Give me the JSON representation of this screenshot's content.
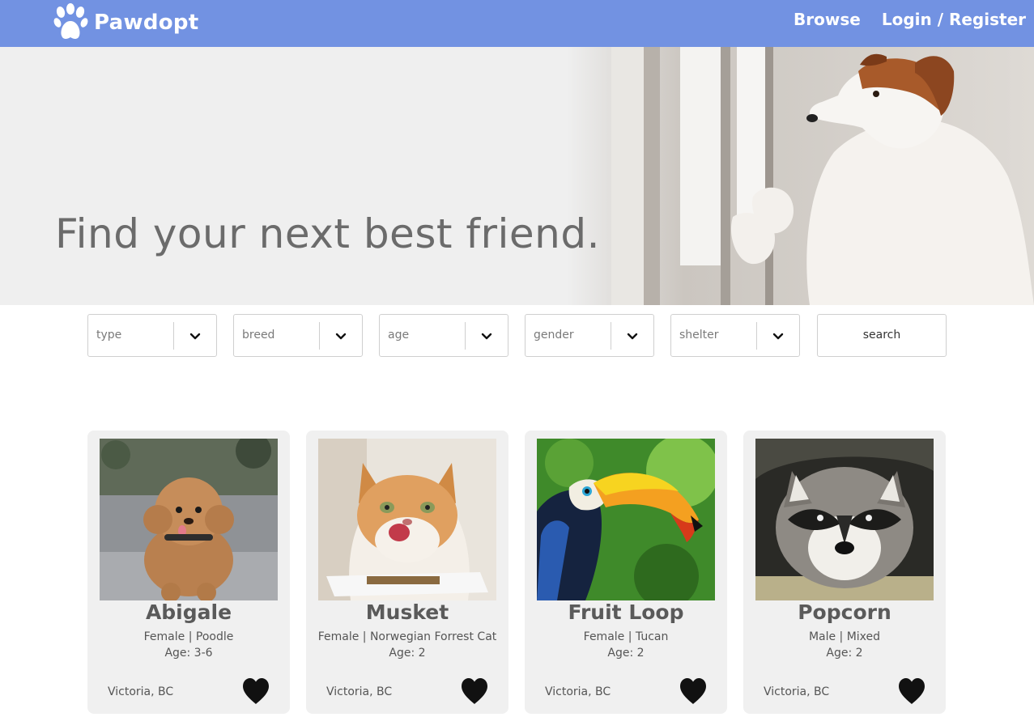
{
  "header": {
    "logo_text": "Pawdopt",
    "nav": [
      "Browse",
      "Login / Register"
    ],
    "color": "#7292e2"
  },
  "hero": {
    "title": "Find your next best friend."
  },
  "filters": [
    {
      "placeholder": "type"
    },
    {
      "placeholder": "breed"
    },
    {
      "placeholder": "age"
    },
    {
      "placeholder": "gender"
    },
    {
      "placeholder": "shelter"
    }
  ],
  "search": {
    "label": "search"
  },
  "pets": [
    {
      "name": "Abigale",
      "info": "Female | Poodle",
      "age": "Age: 3-6",
      "location": "Victoria, BC",
      "image": "poodle-photo"
    },
    {
      "name": "Musket",
      "info": "Female | Norwegian Forrest Cat",
      "age": "Age: 2",
      "location": "Victoria, BC",
      "image": "cat-photo"
    },
    {
      "name": "Fruit Loop",
      "info": "Female | Tucan",
      "age": "Age: 2",
      "location": "Victoria, BC",
      "image": "toucan-photo"
    },
    {
      "name": "Popcorn",
      "info": "Male | Mixed",
      "age": "Age: 2",
      "location": "Victoria, BC",
      "image": "raccoon-photo"
    }
  ],
  "icons": {
    "logo": "paw-icon",
    "filter": "chevron-down-icon",
    "favorite": "heart-icon"
  }
}
